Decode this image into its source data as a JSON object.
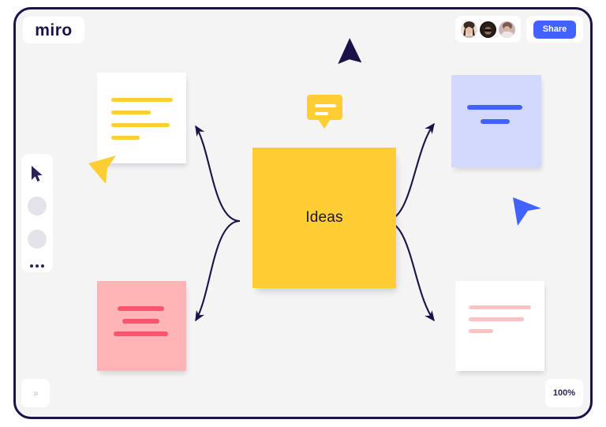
{
  "app": {
    "logo": "miro",
    "share_label": "Share",
    "zoom_level": "100%",
    "expand_label": "»",
    "accent_blue": "#4262FF",
    "navy": "#1B1248",
    "board_background": "#F4F4F4",
    "sticky_yellow": "#FFCE33"
  },
  "collaborators": [
    {
      "name": "avatar-1"
    },
    {
      "name": "avatar-2"
    },
    {
      "name": "avatar-3"
    }
  ],
  "toolbar": {
    "items": [
      {
        "name": "select-tool",
        "icon": "cursor-icon"
      },
      {
        "name": "shape-tool-1",
        "icon": "circle-icon"
      },
      {
        "name": "shape-tool-2",
        "icon": "circle-icon"
      },
      {
        "name": "more-tools",
        "icon": "ellipsis-icon"
      }
    ]
  },
  "canvas": {
    "center_node": {
      "label": "Ideas",
      "color": "#FFCE33"
    },
    "comment_bubble": {
      "name": "comment-bubble",
      "color": "#FFCE33",
      "line_count": 2
    },
    "cards": [
      {
        "name": "card-top-left",
        "background": "#FFFFFF",
        "line_color": "#FFCE33",
        "lines": [
          92,
          60,
          88,
          42
        ]
      },
      {
        "name": "card-top-right",
        "background": "#D3D9FD",
        "line_color": "#4262FF",
        "lines": [
          70,
          38
        ]
      },
      {
        "name": "card-bottom-left",
        "background": "#FFB5B5",
        "line_color": "#F5576C",
        "lines": [
          60,
          48,
          70
        ]
      },
      {
        "name": "card-bottom-right",
        "background": "#FFFFFF",
        "line_color": "#FFC2C2",
        "lines": [
          80,
          70,
          32
        ]
      }
    ],
    "cursors": [
      {
        "name": "cursor-navy",
        "color": "#1B1248"
      },
      {
        "name": "cursor-yellow",
        "color": "#FFCE33"
      },
      {
        "name": "cursor-blue",
        "color": "#4262FF"
      }
    ],
    "connectors": [
      {
        "name": "connector-to-top-left",
        "direction": "left-up"
      },
      {
        "name": "connector-to-top-right",
        "direction": "right-up"
      },
      {
        "name": "connector-to-bottom-left",
        "direction": "left-down"
      },
      {
        "name": "connector-to-bottom-right",
        "direction": "right-down"
      }
    ]
  }
}
